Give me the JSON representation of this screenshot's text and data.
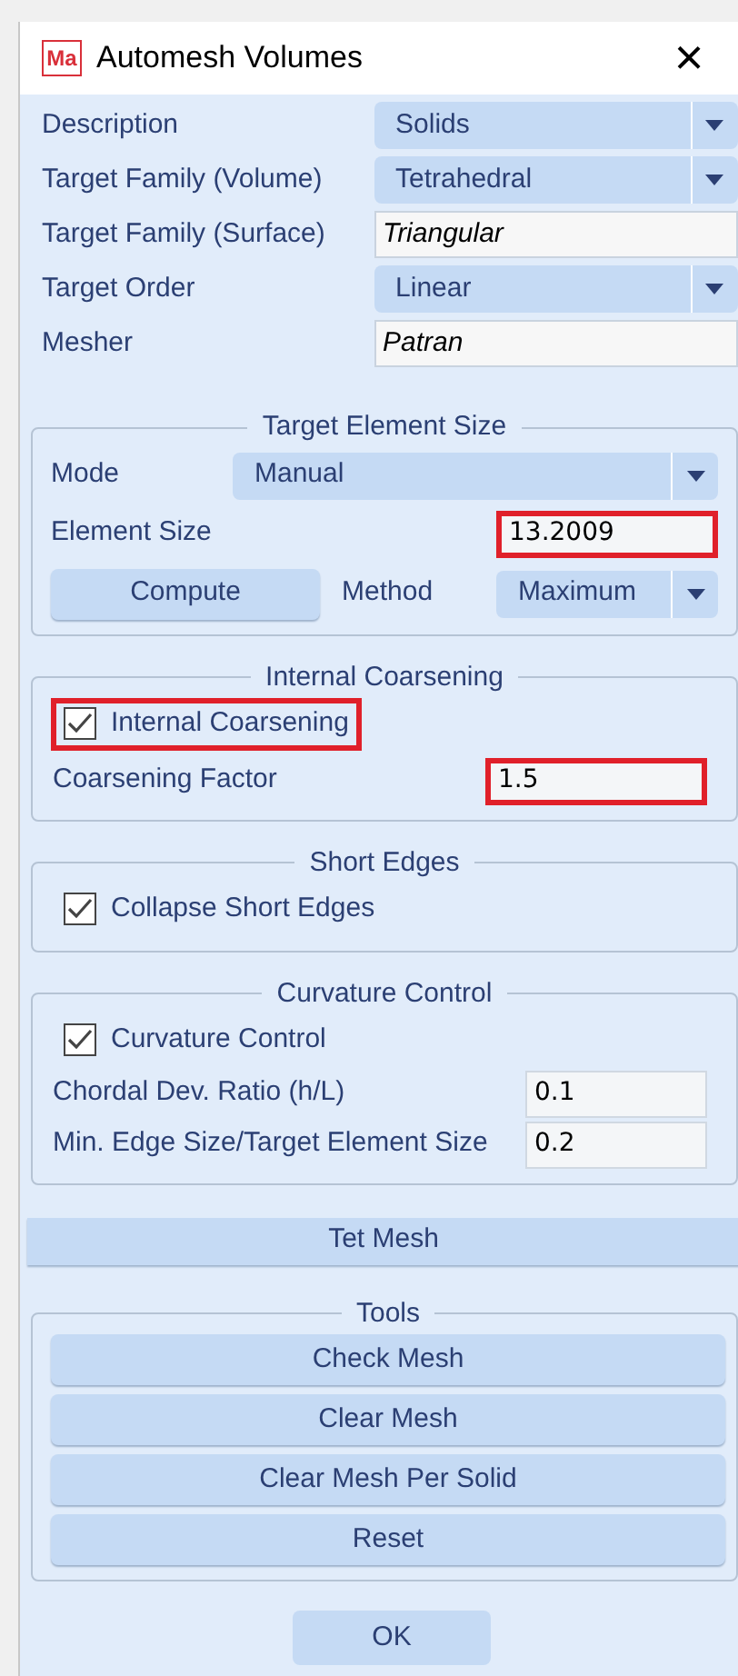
{
  "window": {
    "app_icon": "Ma",
    "title": "Automesh Volumes",
    "close": "×"
  },
  "fields": [
    {
      "label": "Description",
      "kind": "dropdown",
      "value": "Solids"
    },
    {
      "label": "Target Family (Volume)",
      "kind": "dropdown",
      "value": "Tetrahedral"
    },
    {
      "label": "Target Family (Surface)",
      "kind": "text",
      "value": "Triangular"
    },
    {
      "label": "Target Order",
      "kind": "dropdown",
      "value": "Linear"
    },
    {
      "label": "Mesher",
      "kind": "text",
      "value": "Patran"
    }
  ],
  "target_element_size": {
    "title": "Target Element Size",
    "mode": {
      "label": "Mode",
      "value": "Manual"
    },
    "element_size": {
      "label": "Element Size",
      "value": "13.2009",
      "highlighted": true
    },
    "compute_button": "Compute",
    "method": {
      "label": "Method",
      "value": "Maximum"
    }
  },
  "internal_coarsening": {
    "title": "Internal Coarsening",
    "checkbox": {
      "label": "Internal Coarsening",
      "checked": true,
      "highlighted": true
    },
    "factor": {
      "label": "Coarsening Factor",
      "value": "1.5",
      "highlighted": true
    }
  },
  "short_edges": {
    "title": "Short Edges",
    "checkbox": {
      "label": "Collapse Short Edges",
      "checked": true
    }
  },
  "curvature_control": {
    "title": "Curvature Control",
    "checkbox": {
      "label": "Curvature Control",
      "checked": true
    },
    "fields": [
      {
        "label": "Chordal Dev. Ratio (h/L)",
        "value": "0.1"
      },
      {
        "label": "Min. Edge Size/Target Element Size",
        "value": "0.2"
      }
    ]
  },
  "tet_mesh_button": "Tet Mesh",
  "tools": {
    "title": "Tools",
    "buttons": [
      "Check Mesh",
      "Clear Mesh",
      "Clear Mesh Per Solid",
      "Reset"
    ]
  },
  "ok_button": "OK"
}
